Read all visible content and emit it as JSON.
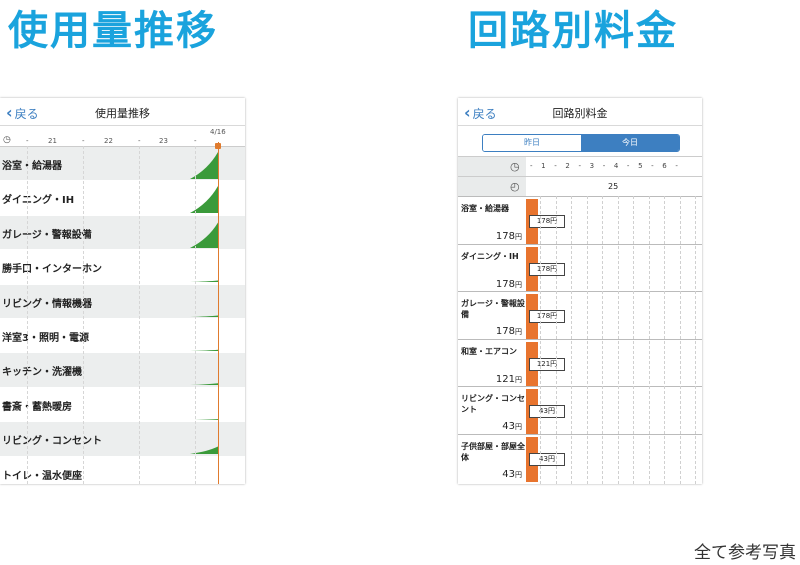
{
  "titles": {
    "left": "使用量推移",
    "right": "回路別料金"
  },
  "footnote": "全て参考写真",
  "phone1": {
    "back": "戻る",
    "title": "使用量推移",
    "date": "4/16",
    "time_labels": [
      "21",
      "22",
      "23"
    ],
    "rows": [
      {
        "label": "浴室・給湯器",
        "level": 0.9
      },
      {
        "label": "ダイニング・IH",
        "level": 0.9
      },
      {
        "label": "ガレージ・警報設備",
        "level": 0.85
      },
      {
        "label": "勝手口・インターホン",
        "level": 0.05
      },
      {
        "label": "リビング・情報機器",
        "level": 0.05
      },
      {
        "label": "洋室3・照明・電源",
        "level": 0.04
      },
      {
        "label": "キッチン・洗濯機",
        "level": 0.06
      },
      {
        "label": "書斎・蓄熱暖房",
        "level": 0.03
      },
      {
        "label": "リビング・コンセント",
        "level": 0.25
      },
      {
        "label": "トイレ・温水便座",
        "level": 0.03
      }
    ],
    "colors": {
      "shade": "#eceeee",
      "area": "#3a9a3a",
      "marker": "#e07b2e"
    }
  },
  "phone2": {
    "back": "戻る",
    "title": "回路別料金",
    "tabs": {
      "yesterday": "昨日",
      "today": "今日"
    },
    "ticks": "- 1 - 2 - 3 - 4 - 5 - 6 -",
    "day": "25",
    "unit": "円",
    "circuits": [
      {
        "name": "浴室・給湯器",
        "amount": "178",
        "chip": "178円"
      },
      {
        "name": "ダイニング・IH",
        "amount": "178",
        "chip": "178円"
      },
      {
        "name": "ガレージ・警報設備",
        "amount": "178",
        "chip": "178円"
      },
      {
        "name": "和室・エアコン",
        "amount": "121",
        "chip": "121円"
      },
      {
        "name": "リビング・コンセント",
        "amount": "43",
        "chip": "43円"
      },
      {
        "name": "子供部屋・部屋全体",
        "amount": "43",
        "chip": "43円"
      }
    ],
    "colors": {
      "bar": "#e8742e",
      "accent": "#3d7fc1"
    }
  }
}
